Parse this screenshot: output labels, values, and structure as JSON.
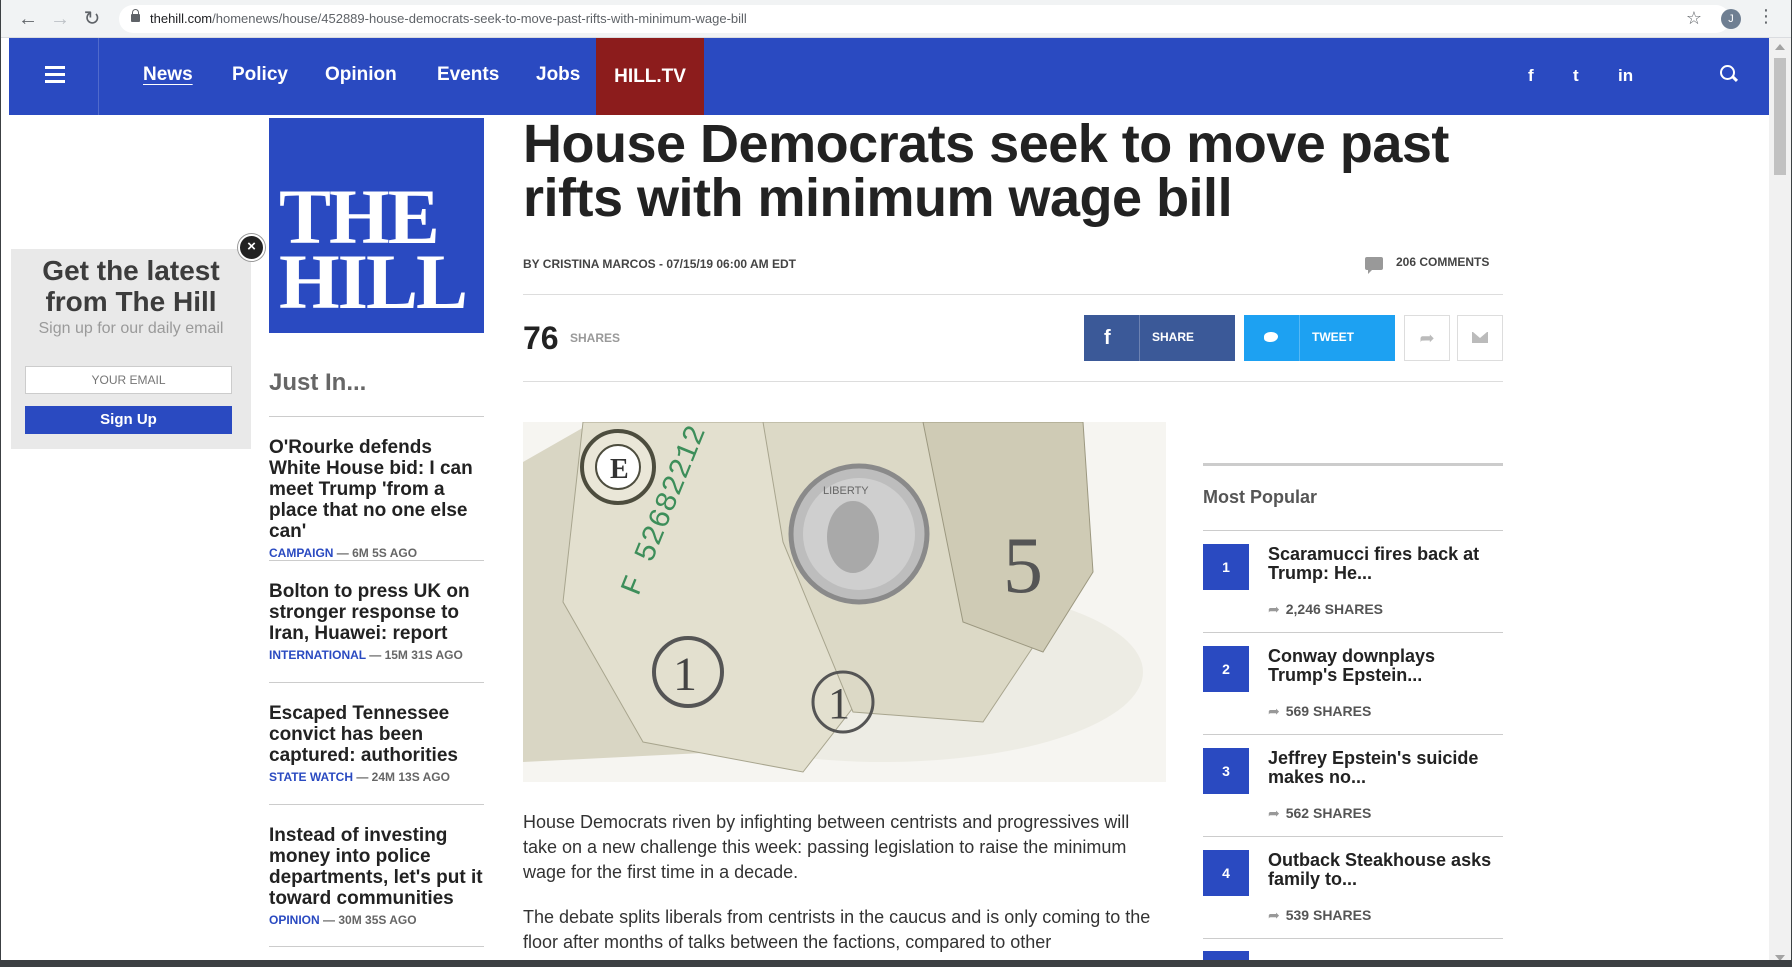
{
  "browser": {
    "url_domain": "thehill.com",
    "url_path": "/homenews/house/452889-house-democrats-seek-to-move-past-rifts-with-minimum-wage-bill",
    "profile_initial": "J"
  },
  "nav": {
    "items": [
      "News",
      "Policy",
      "Opinion",
      "Events",
      "Jobs"
    ],
    "hilltv": "HILL.TV",
    "social": [
      "f",
      "t",
      "in"
    ]
  },
  "logo": {
    "line1": "THE",
    "line2": "HILL"
  },
  "popup": {
    "heading": "Get the latest from The Hill",
    "subheading": "Sign up for our daily email",
    "email_placeholder": "YOUR EMAIL",
    "signup_label": "Sign Up"
  },
  "just_in": {
    "title": "Just In...",
    "items": [
      {
        "headline": "O'Rourke defends White House bid: I can meet Trump 'from a place that no one else can'",
        "category": "CAMPAIGN",
        "time": "— 6M 5S AGO"
      },
      {
        "headline": "Bolton to press UK on stronger response to Iran, Huawei: report",
        "category": "INTERNATIONAL",
        "time": "— 15M 31S AGO"
      },
      {
        "headline": "Escaped Tennessee convict has been captured: authorities",
        "category": "STATE WATCH",
        "time": "— 24M 13S AGO"
      },
      {
        "headline": "Instead of investing money into police departments, let's put it toward communities",
        "category": "OPINION",
        "time": "— 30M 35S AGO"
      }
    ]
  },
  "article": {
    "headline": "House Democrats seek to move past rifts with minimum wage bill",
    "byline": "BY CRISTINA MARCOS - 07/15/19 06:00 AM EDT",
    "comments": "206 COMMENTS",
    "shares_count": "76",
    "shares_label": "SHARES",
    "fb_label": "SHARE",
    "tw_label": "TWEET",
    "paragraphs": [
      "House Democrats riven by infighting between centrists and progressives will take on a new challenge this week: passing legislation to raise the minimum wage for the first time in a decade.",
      "The debate splits liberals from centrists in the caucus and is only coming to the floor after months of talks between the factions, compared to other"
    ]
  },
  "most_popular": {
    "title": "Most Popular",
    "items": [
      {
        "rank": "1",
        "headline": "Scaramucci fires back at Trump: He...",
        "shares": "2,246 SHARES"
      },
      {
        "rank": "2",
        "headline": "Conway downplays Trump's Epstein...",
        "shares": "569 SHARES"
      },
      {
        "rank": "3",
        "headline": "Jeffrey Epstein's suicide makes no...",
        "shares": "562 SHARES"
      },
      {
        "rank": "4",
        "headline": "Outback Steakhouse asks family to...",
        "shares": "539 SHARES"
      }
    ]
  },
  "colors": {
    "brand_blue": "#2a4ac1",
    "hilltv_red": "#8c1c1c",
    "facebook": "#3b5998",
    "twitter": "#1da1f2"
  }
}
